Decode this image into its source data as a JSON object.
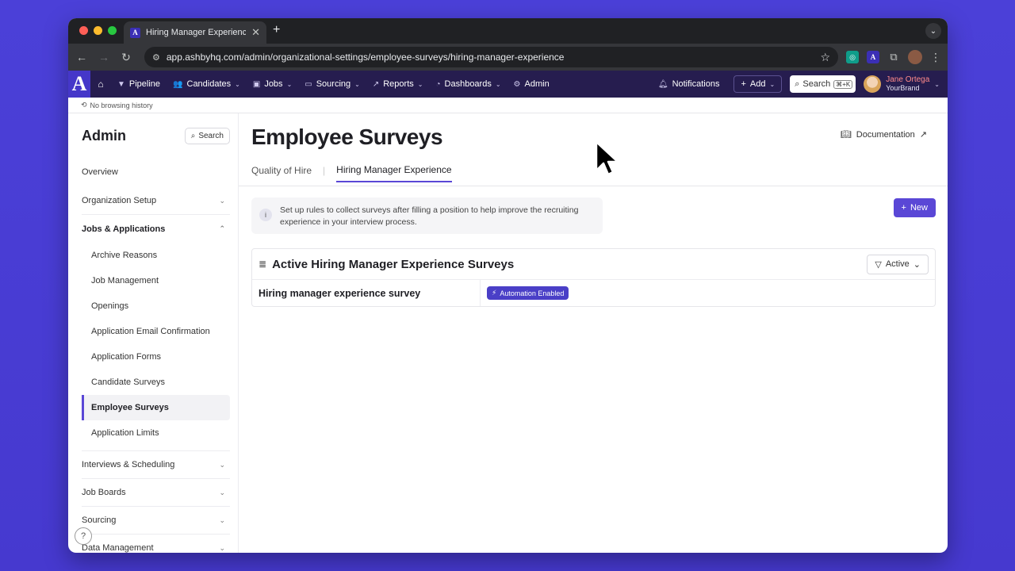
{
  "browser": {
    "tab_title": "Hiring Manager Experience S",
    "tab_favicon": "A",
    "url": "app.ashbyhq.com/admin/organizational-settings/employee-surveys/hiring-manager-experience",
    "ext_ashby": "A"
  },
  "appnav": {
    "logo": "A",
    "items": [
      {
        "label": "Pipeline",
        "icon": "filter-icon",
        "caret": false
      },
      {
        "label": "Candidates",
        "icon": "people-icon",
        "caret": true
      },
      {
        "label": "Jobs",
        "icon": "briefcase-icon",
        "caret": true
      },
      {
        "label": "Sourcing",
        "icon": "inbox-icon",
        "caret": true
      },
      {
        "label": "Reports",
        "icon": "chart-icon",
        "caret": true
      },
      {
        "label": "Dashboards",
        "icon": "gauge-icon",
        "caret": true
      },
      {
        "label": "Admin",
        "icon": "gear-icon",
        "caret": false
      }
    ],
    "notifications": "Notifications",
    "add": "Add",
    "search": "Search",
    "search_kbd": "⌘+K",
    "user_name": "Jane Ortega",
    "user_org": "YourBrand"
  },
  "history": "No browsing history",
  "sidebar": {
    "title": "Admin",
    "search": "Search",
    "overview": "Overview",
    "org_setup": "Organization Setup",
    "jobs_apps": "Jobs & Applications",
    "sub_items": [
      "Archive Reasons",
      "Job Management",
      "Openings",
      "Application Email Confirmation",
      "Application Forms",
      "Candidate Surveys",
      "Employee Surveys",
      "Application Limits"
    ],
    "active_sub": "Employee Surveys",
    "more_sections": [
      "Interviews & Scheduling",
      "Job Boards",
      "Sourcing",
      "Data Management"
    ],
    "help": "?"
  },
  "main": {
    "title": "Employee Surveys",
    "documentation": "Documentation",
    "tabs": [
      "Quality of Hire",
      "Hiring Manager Experience"
    ],
    "info": "Set up rules to collect surveys after filling a position to help improve the recruiting experience in your interview process.",
    "new_button": "New",
    "section_title": "Active Hiring Manager Experience Surveys",
    "filter": "Active",
    "rows": [
      {
        "name": "Hiring manager experience survey",
        "badge": "Automation Enabled"
      }
    ]
  }
}
